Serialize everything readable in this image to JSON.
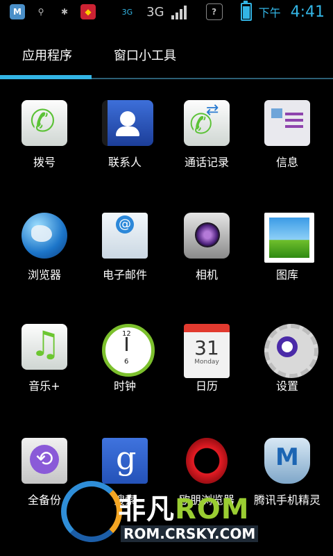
{
  "statusbar": {
    "left_icons": [
      "app-icon",
      "usb-icon",
      "android-debug-icon",
      "shield-app-icon"
    ],
    "net_small": "3G",
    "net": "3G",
    "ampm": "下午",
    "time": "4:41"
  },
  "tabs": {
    "apps": "应用程序",
    "widgets": "窗口小工具"
  },
  "apps": [
    {
      "label": "拨号",
      "icon": "phone-dial-icon"
    },
    {
      "label": "联系人",
      "icon": "contacts-icon"
    },
    {
      "label": "通话记录",
      "icon": "call-log-icon"
    },
    {
      "label": "信息",
      "icon": "messaging-icon"
    },
    {
      "label": "浏览器",
      "icon": "browser-globe-icon"
    },
    {
      "label": "电子邮件",
      "icon": "email-icon"
    },
    {
      "label": "相机",
      "icon": "camera-icon"
    },
    {
      "label": "图库",
      "icon": "gallery-icon"
    },
    {
      "label": "音乐+",
      "icon": "music-icon"
    },
    {
      "label": "时钟",
      "icon": "clock-icon"
    },
    {
      "label": "日历",
      "icon": "calendar-icon"
    },
    {
      "label": "设置",
      "icon": "settings-gear-icon"
    },
    {
      "label": "全备份",
      "icon": "backup-icon"
    },
    {
      "label": "搜索",
      "icon": "google-search-icon"
    },
    {
      "label": "欧朋浏览器",
      "icon": "opera-icon"
    },
    {
      "label": "腾讯手机精灵",
      "icon": "security-shield-icon"
    }
  ],
  "calendar": {
    "day": "31",
    "weekday": "Monday"
  },
  "clock": {
    "n12": "12",
    "n6": "6"
  },
  "watermark": {
    "line1_a": "非凡",
    "line1_b": "ROM",
    "line2": "ROM.CRSKY.COM"
  }
}
